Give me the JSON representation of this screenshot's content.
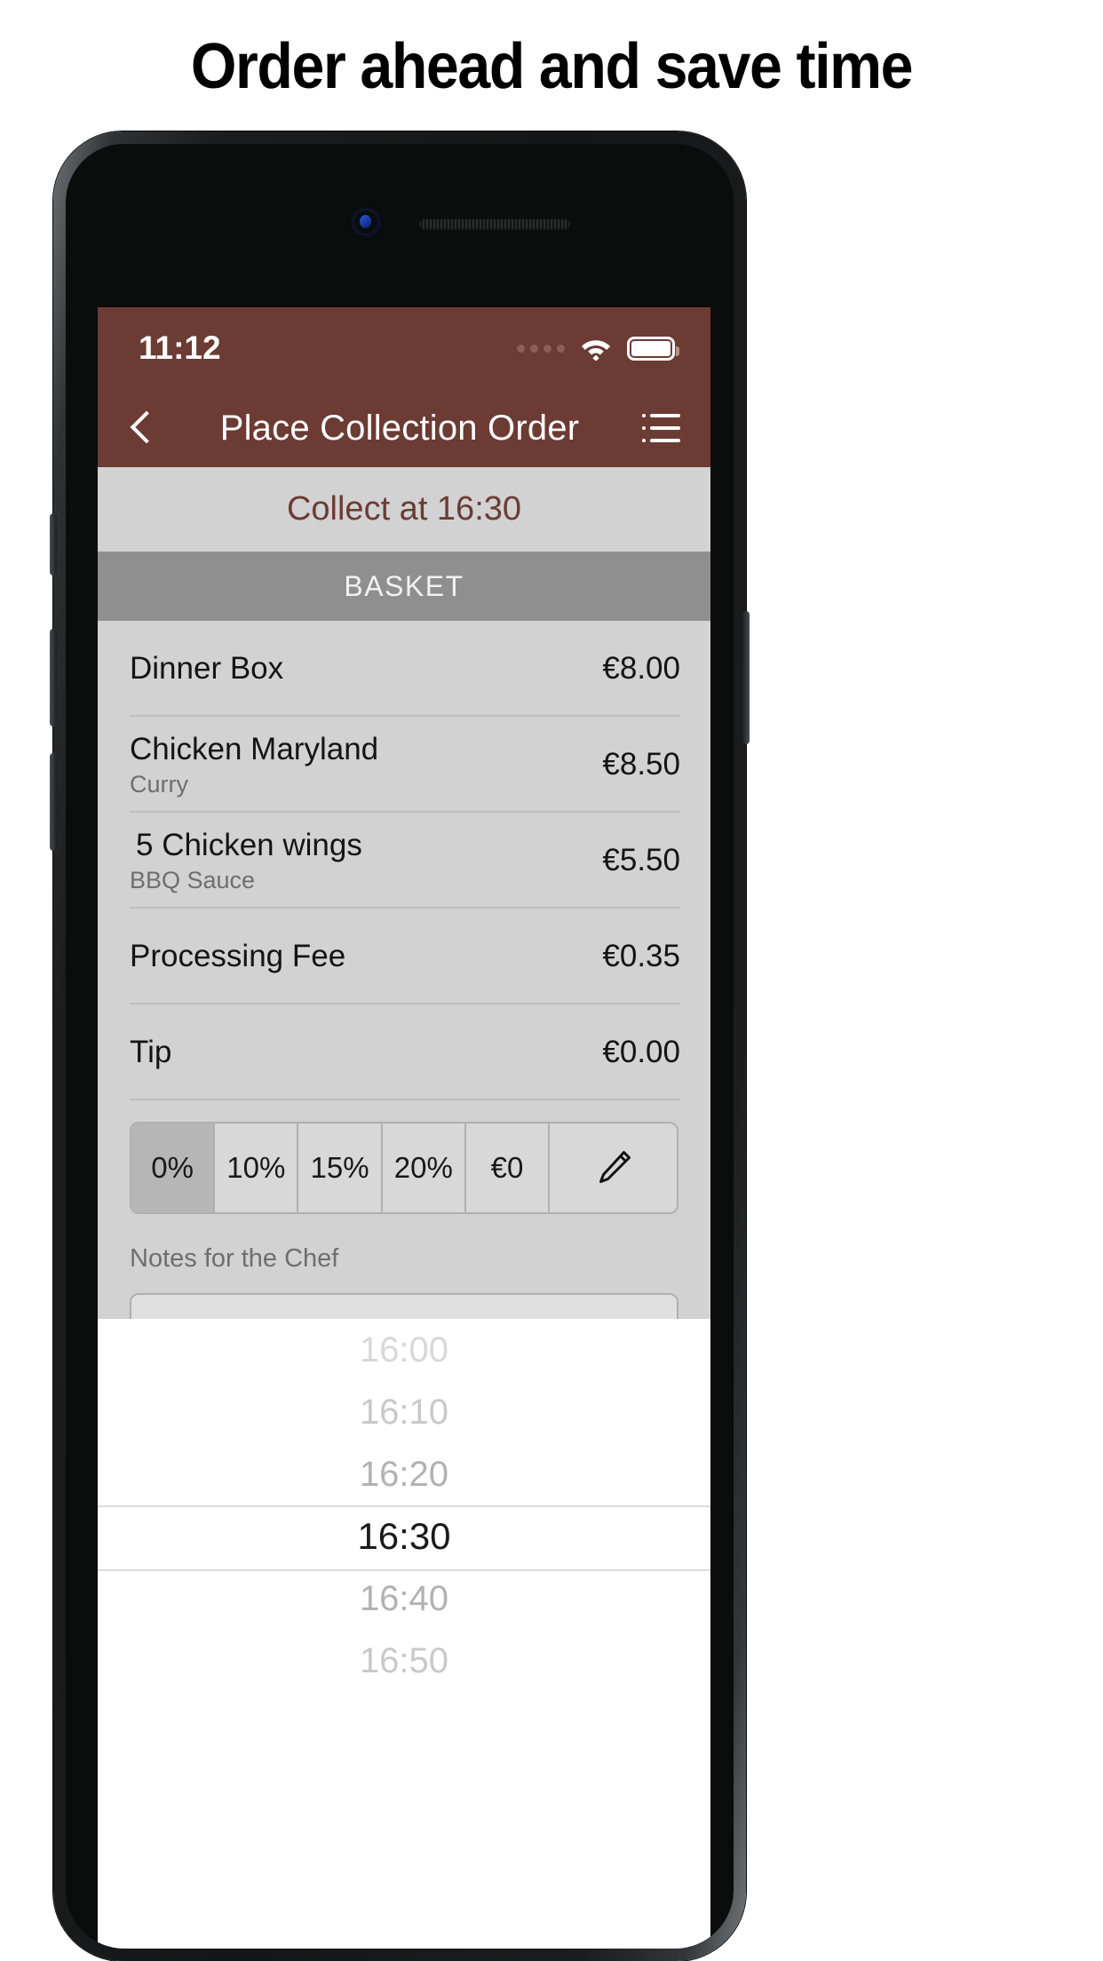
{
  "headline": "Order ahead and save time",
  "phone": {
    "camera_icon": "front-camera",
    "speaker_icon": "earpiece-speaker"
  },
  "status_bar": {
    "time": "11:12",
    "signal_icon": "signal-dots",
    "wifi_icon": "wifi-icon",
    "battery_icon": "battery-full-icon"
  },
  "navbar": {
    "back_icon": "back-chevron-icon",
    "title": "Place Collection Order",
    "menu_icon": "list-menu-icon"
  },
  "collect": {
    "label": "Collect at 16:30"
  },
  "basket": {
    "section_title": "BASKET",
    "items": [
      {
        "name": "Dinner Box",
        "sub": "",
        "price": "€8.00"
      },
      {
        "name": "Chicken Maryland",
        "sub": "Curry",
        "price": "€8.50"
      },
      {
        "name": " 5 Chicken wings",
        "sub": "BBQ Sauce",
        "price": "€5.50"
      },
      {
        "name": "Processing Fee",
        "sub": "",
        "price": "€0.35"
      },
      {
        "name": "Tip",
        "sub": "",
        "price": "€0.00"
      }
    ]
  },
  "tip": {
    "options": [
      "0%",
      "10%",
      "15%",
      "20%",
      "€0"
    ],
    "selected_index": 0,
    "edit_icon": "pencil-edit-icon"
  },
  "notes": {
    "label": "Notes for the Chef",
    "value": "",
    "placeholder": ""
  },
  "time_picker": {
    "options": [
      "16:00",
      "16:10",
      "16:20",
      "16:30",
      "16:40",
      "16:50"
    ],
    "selected": "16:30"
  },
  "colors": {
    "brand_maroon": "#6B3B34",
    "light_gray": "#D2D2D2",
    "mid_gray": "#8F8F8F"
  }
}
